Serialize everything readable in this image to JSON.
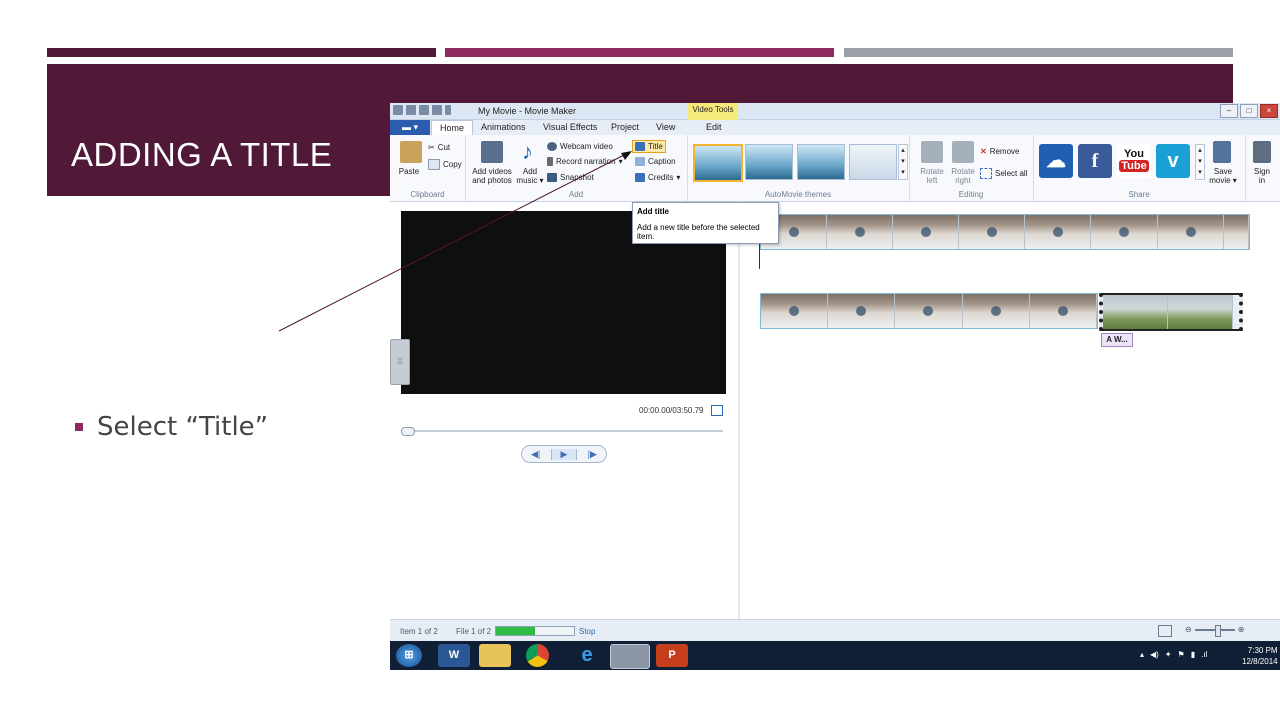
{
  "slide": {
    "title": "ADDING A TITLE",
    "bullet": "Select “Title”",
    "colors": {
      "bar1": "#4f1937",
      "bar2": "#8e2a5e",
      "bar3": "#9aa0a6",
      "band": "#4f1937"
    }
  },
  "window": {
    "title": "My Movie - Movie Maker",
    "contextual_tab": "Video Tools",
    "file_tab_icon": "file-menu-icon",
    "tabs": [
      "Home",
      "Animations",
      "Visual Effects",
      "Project",
      "View",
      "Edit"
    ]
  },
  "ribbon": {
    "clipboard": {
      "label": "Clipboard",
      "paste": "Paste",
      "cut": "Cut",
      "copy": "Copy"
    },
    "add": {
      "label": "Add",
      "add_videos_line1": "Add videos",
      "add_videos_line2": "and photos",
      "add_music_line1": "Add",
      "add_music_line2": "music",
      "webcam": "Webcam video",
      "narration": "Record narration",
      "snapshot": "Snapshot",
      "title": "Title",
      "caption": "Caption",
      "credits": "Credits"
    },
    "themes": {
      "label": "AutoMovie themes"
    },
    "editing": {
      "label": "Editing",
      "rotate_left_line1": "Rotate",
      "rotate_left_line2": "left",
      "rotate_right_line1": "Rotate",
      "rotate_right_line2": "right",
      "remove": "Remove",
      "select_all": "Select all"
    },
    "share": {
      "label": "Share",
      "save_movie_line1": "Save",
      "save_movie_line2": "movie",
      "sign_in_line1": "Sign",
      "sign_in_line2": "in",
      "facebook": "f",
      "youtube_top": "You",
      "youtube_bottom": "Tube",
      "vimeo": "v"
    }
  },
  "tooltip": {
    "heading": "Add title",
    "body": "Add a new title before the selected item."
  },
  "player": {
    "timecode": "00:00.00/03:50.79",
    "seek_fraction": 0.0
  },
  "caption_tag": "A W...",
  "statusbar": {
    "item": "Item 1 of 2",
    "file": "File 1 of 2",
    "progress_fraction": 0.5,
    "stop": "Stop"
  },
  "taskbar": {
    "time": "7:30 PM",
    "date": "12/8/2014",
    "word": "W",
    "powerpoint": "P"
  }
}
